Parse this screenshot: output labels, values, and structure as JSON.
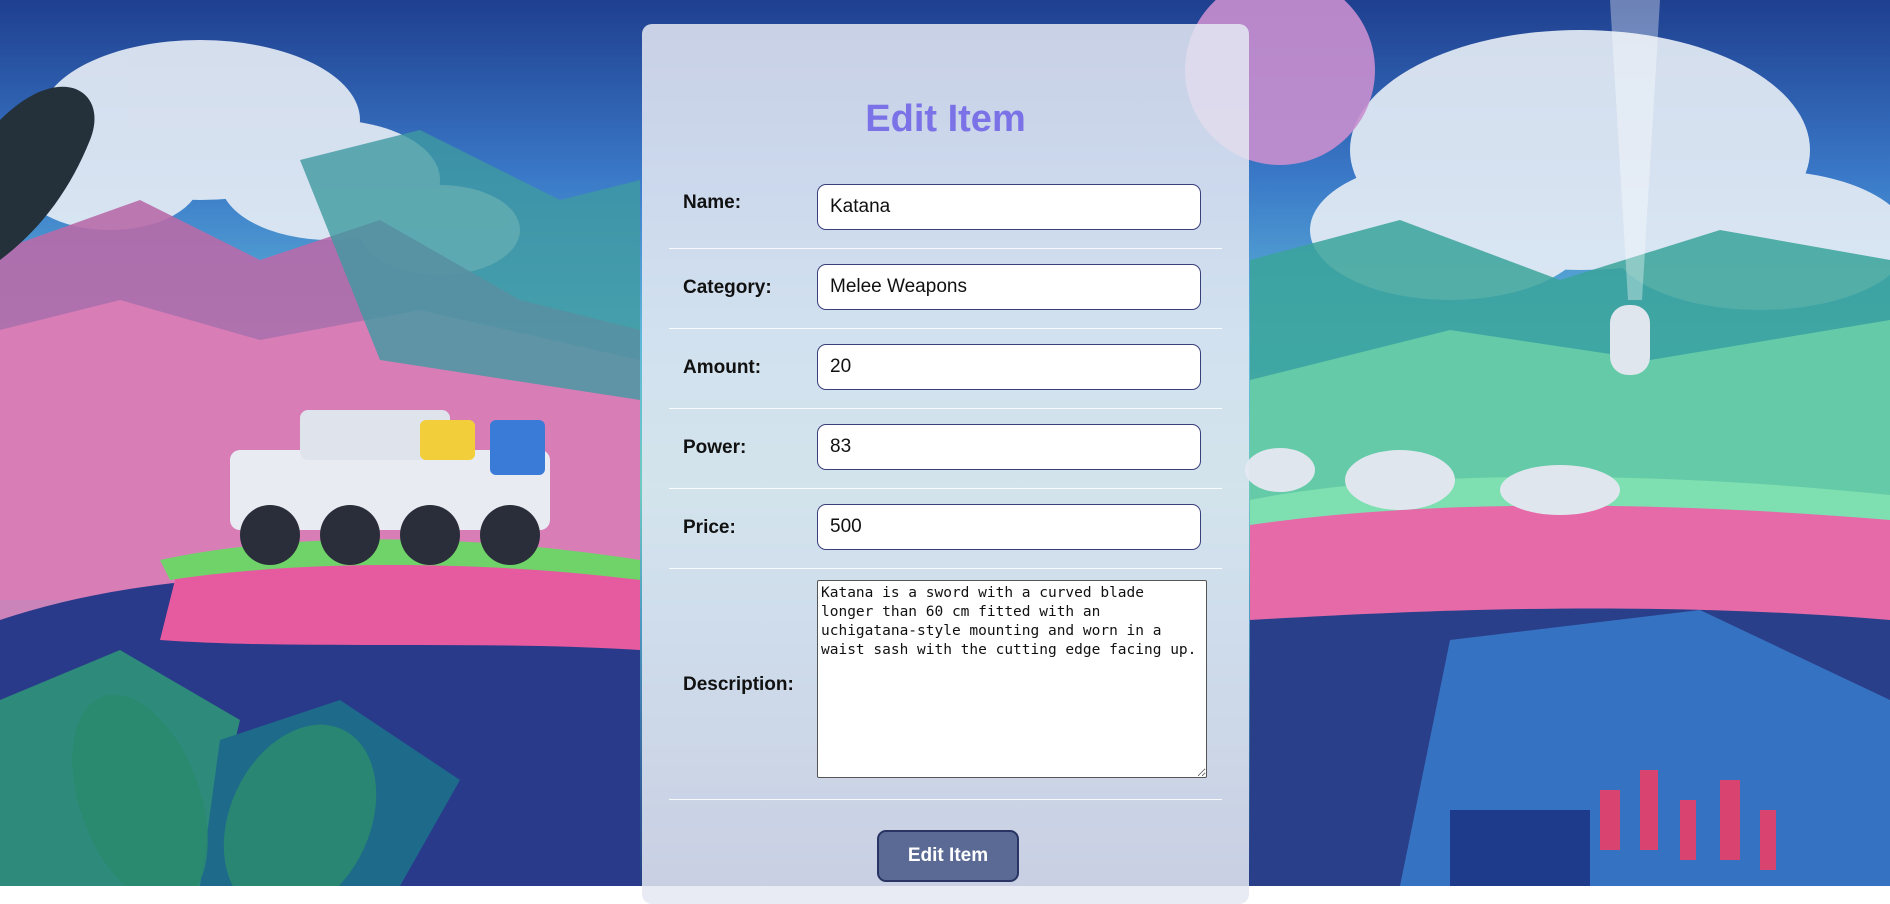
{
  "form": {
    "title": "Edit Item",
    "fields": [
      {
        "label": "Name:",
        "value": "Katana"
      },
      {
        "label": "Category:",
        "value": "Melee Weapons"
      },
      {
        "label": "Amount:",
        "value": "20"
      },
      {
        "label": "Power:",
        "value": "83"
      },
      {
        "label": "Price:",
        "value": "500"
      }
    ],
    "description": {
      "label": "Description:",
      "value": "Katana is a sword with a curved blade longer than 60 cm fitted with an uchigatana-style mounting and worn in a waist sash with the cutting edge facing up."
    },
    "submit_label": "Edit Item"
  },
  "colors": {
    "title": "#7a72e6",
    "button_bg": "#5a6a94",
    "input_border": "#3a3f7a"
  }
}
